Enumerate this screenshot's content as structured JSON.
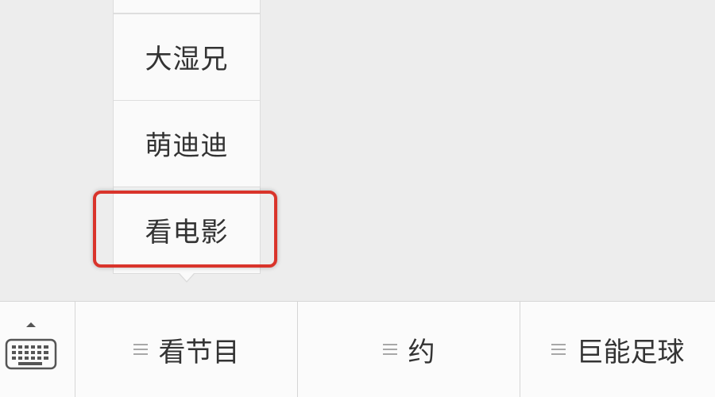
{
  "popup": {
    "items": [
      {
        "label": ""
      },
      {
        "label": "大湿兄"
      },
      {
        "label": "萌迪迪"
      },
      {
        "label": "看电影"
      }
    ],
    "highlight_color": "#d9342b"
  },
  "menubar": {
    "keyboard_icon": "keyboard-icon",
    "items": [
      {
        "label": "看节目",
        "icon": "menu-lines-icon"
      },
      {
        "label": "约",
        "icon": "menu-lines-icon"
      },
      {
        "label": "巨能足球",
        "icon": "menu-lines-icon"
      }
    ]
  }
}
